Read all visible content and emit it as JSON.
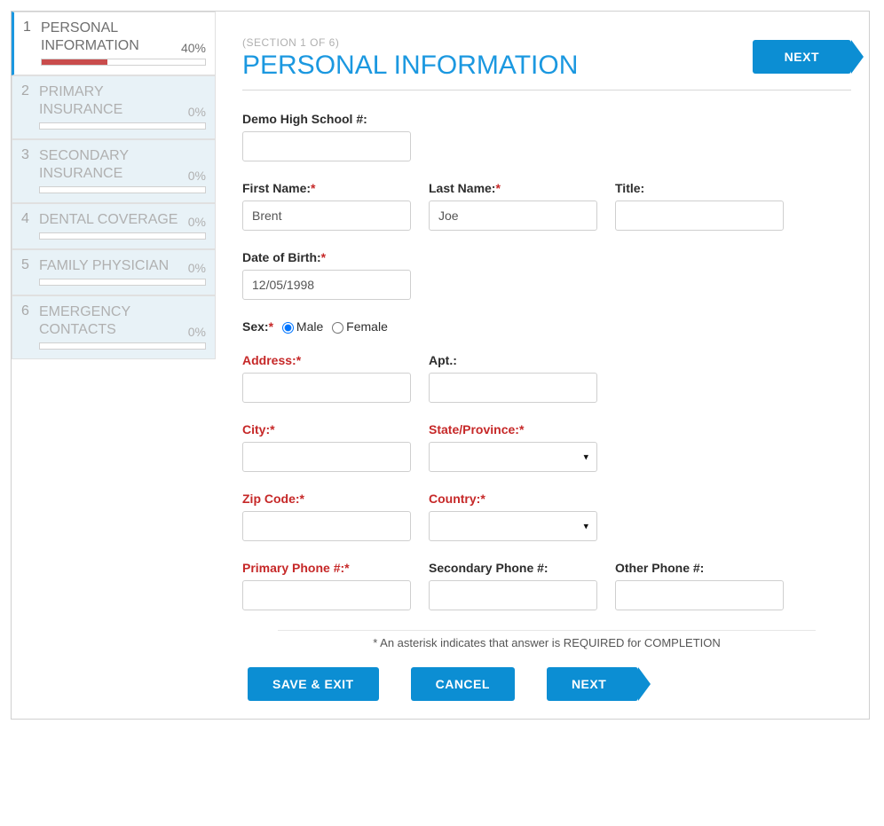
{
  "sidebar": {
    "steps": [
      {
        "label": "PERSONAL INFORMATION",
        "pct": "40%",
        "fill": 40,
        "active": true
      },
      {
        "label": "PRIMARY INSURANCE",
        "pct": "0%",
        "fill": 0,
        "active": false
      },
      {
        "label": "SECONDARY INSURANCE",
        "pct": "0%",
        "fill": 0,
        "active": false
      },
      {
        "label": "DENTAL COVERAGE",
        "pct": "0%",
        "fill": 0,
        "active": false
      },
      {
        "label": "FAMILY PHYSICIAN",
        "pct": "0%",
        "fill": 0,
        "active": false
      },
      {
        "label": "EMERGENCY CONTACTS",
        "pct": "0%",
        "fill": 0,
        "active": false
      }
    ]
  },
  "header": {
    "section_num": "(SECTION 1 OF 6)",
    "title": "PERSONAL INFORMATION",
    "next": "NEXT"
  },
  "fields": {
    "school_label": "Demo High School #:",
    "school_value": "",
    "first_name_label": "First Name:",
    "first_name_value": "Brent",
    "last_name_label": "Last Name:",
    "last_name_value": "Joe",
    "title_label": "Title:",
    "title_value": "",
    "dob_label": "Date of Birth:",
    "dob_value": "12/05/1998",
    "sex_label": "Sex:",
    "sex_male": "Male",
    "sex_female": "Female",
    "address_label": "Address:",
    "apt_label": "Apt.:",
    "city_label": "City:",
    "state_label": "State/Province:",
    "zip_label": "Zip Code:",
    "country_label": "Country:",
    "pphone_label": "Primary Phone #:",
    "sphone_label": "Secondary Phone #:",
    "ophone_label": "Other Phone #:"
  },
  "footnote": "* An asterisk indicates that answer is REQUIRED for COMPLETION",
  "buttons": {
    "save_exit": "SAVE & EXIT",
    "cancel": "CANCEL",
    "next": "NEXT"
  }
}
